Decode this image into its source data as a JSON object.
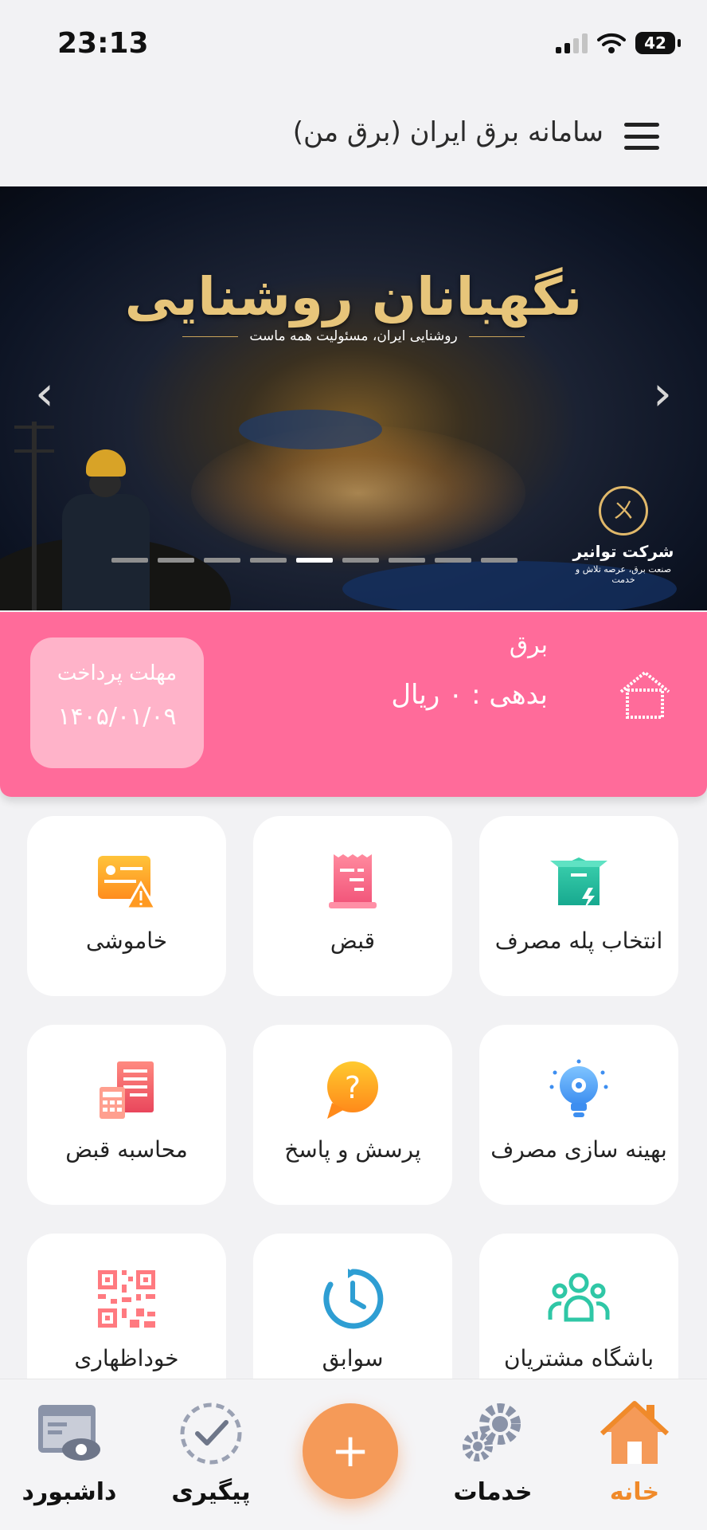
{
  "status_bar": {
    "time": "23:13",
    "battery": "42"
  },
  "header": {
    "title": "سامانه برق ایران (برق من)"
  },
  "banner": {
    "title": "نگهبانان روشنایی",
    "subtitle": "روشنایی ایران، مسئولیت همه ماست",
    "logo_name": "شرکت توانیر",
    "logo_tagline": "صنعت برق، عرصه تلاش و خدمت",
    "slide_count": 9,
    "active_slide": 5
  },
  "bill_card": {
    "type": "برق",
    "debt": "بدهی : ۰ ریال",
    "due_label": "مهلت پرداخت",
    "due_date": "۱۴۰۵/۰۱/۰۹"
  },
  "services": [
    {
      "label": "انتخاب پله مصرف",
      "icon": "box-lightning-icon"
    },
    {
      "label": "قبض",
      "icon": "receipt-icon"
    },
    {
      "label": "خاموشی",
      "icon": "outage-warning-icon"
    },
    {
      "label": "بهینه سازی مصرف",
      "icon": "bulb-gear-icon"
    },
    {
      "label": "پرسش و پاسخ",
      "icon": "question-bubble-icon"
    },
    {
      "label": "محاسبه قبض",
      "icon": "calculator-icon"
    },
    {
      "label": "باشگاه مشتریان",
      "icon": "users-icon"
    },
    {
      "label": "سوابق",
      "icon": "clock-history-icon"
    },
    {
      "label": "خوداظهاری",
      "icon": "qr-code-icon"
    }
  ],
  "tabbar": {
    "home": "خانه",
    "services": "خدمات",
    "fab": "+",
    "tracking": "پیگیری",
    "dashboard": "داشبورد"
  },
  "colors": {
    "accent": "#f08a2a",
    "card_pink": "#ff6b9a",
    "due_pink": "#ffb3c9"
  }
}
